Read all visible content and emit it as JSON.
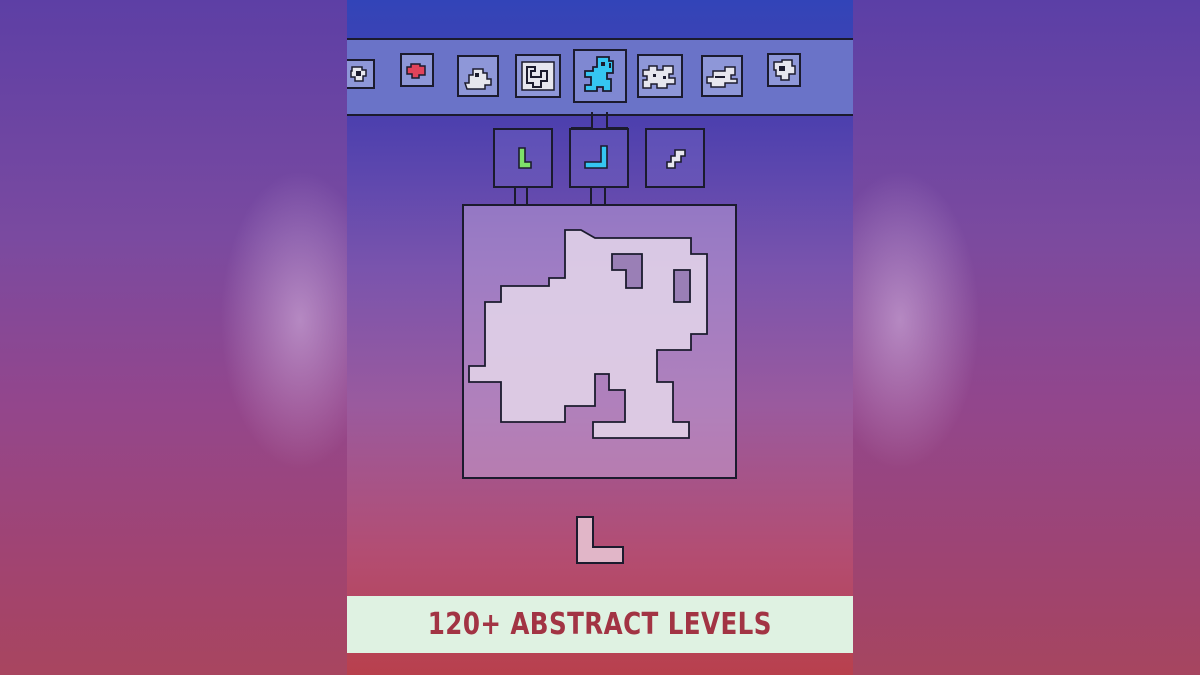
{
  "caption": "120+ ABSTRACT LEVELS",
  "levels": [
    {
      "icon": "swirl-shape-icon",
      "state": "partial"
    },
    {
      "icon": "red-blob-icon",
      "state": "completed"
    },
    {
      "icon": "rock-shape-icon",
      "state": "locked"
    },
    {
      "icon": "maze-shape-icon",
      "state": "locked"
    },
    {
      "icon": "cyan-creature-icon",
      "state": "selected"
    },
    {
      "icon": "puzzle-shape-icon",
      "state": "locked"
    },
    {
      "icon": "fish-shape-icon",
      "state": "locked"
    },
    {
      "icon": "face-shape-icon",
      "state": "partial"
    }
  ],
  "pieces": [
    {
      "icon": "green-l-piece-icon",
      "color": "#7ee06a"
    },
    {
      "icon": "cyan-j-piece-icon",
      "color": "#35c6f2"
    },
    {
      "icon": "white-s-piece-icon",
      "color": "#e6e6ee"
    }
  ],
  "colors": {
    "board_fill": "#e4d6ea",
    "active_piece": "#e1b6c8",
    "outline": "#1b1b2e"
  }
}
